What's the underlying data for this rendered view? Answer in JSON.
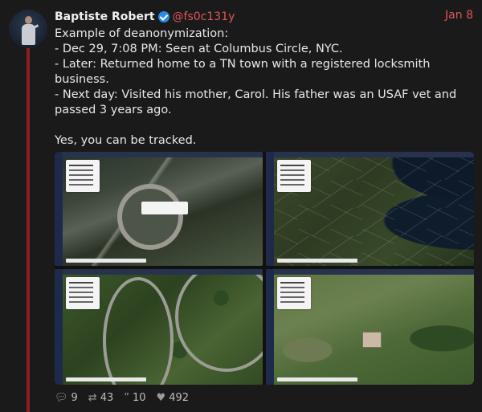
{
  "author": {
    "name": "Baptiste Robert",
    "handle": "@fs0c131y",
    "verified_icon": "verified-badge-icon"
  },
  "tweet": {
    "date": "Jan 8",
    "lines": [
      "Example of deanonymization:",
      "- Dec 29, 7:08 PM: Seen at Columbus Circle, NYC.",
      "- Later: Returned home to a TN town with a registered locksmith",
      "business.",
      "- Next day: Visited his mother, Carol. His father was an USAF vet and",
      "passed 3 years ago.",
      "",
      "Yes, you can be tracked."
    ]
  },
  "media": [
    {
      "name": "map-screenshot-columbus-circle"
    },
    {
      "name": "map-screenshot-east-coast"
    },
    {
      "name": "map-screenshot-neighborhood"
    },
    {
      "name": "map-screenshot-property"
    }
  ],
  "actions": {
    "replies": "9",
    "retweets": "43",
    "quotes": "10",
    "likes": "492"
  },
  "colors": {
    "background": "#1a1a1a",
    "accent": "#e0565a",
    "thread_line": "#8a1f24",
    "verified": "#2a8be6"
  }
}
